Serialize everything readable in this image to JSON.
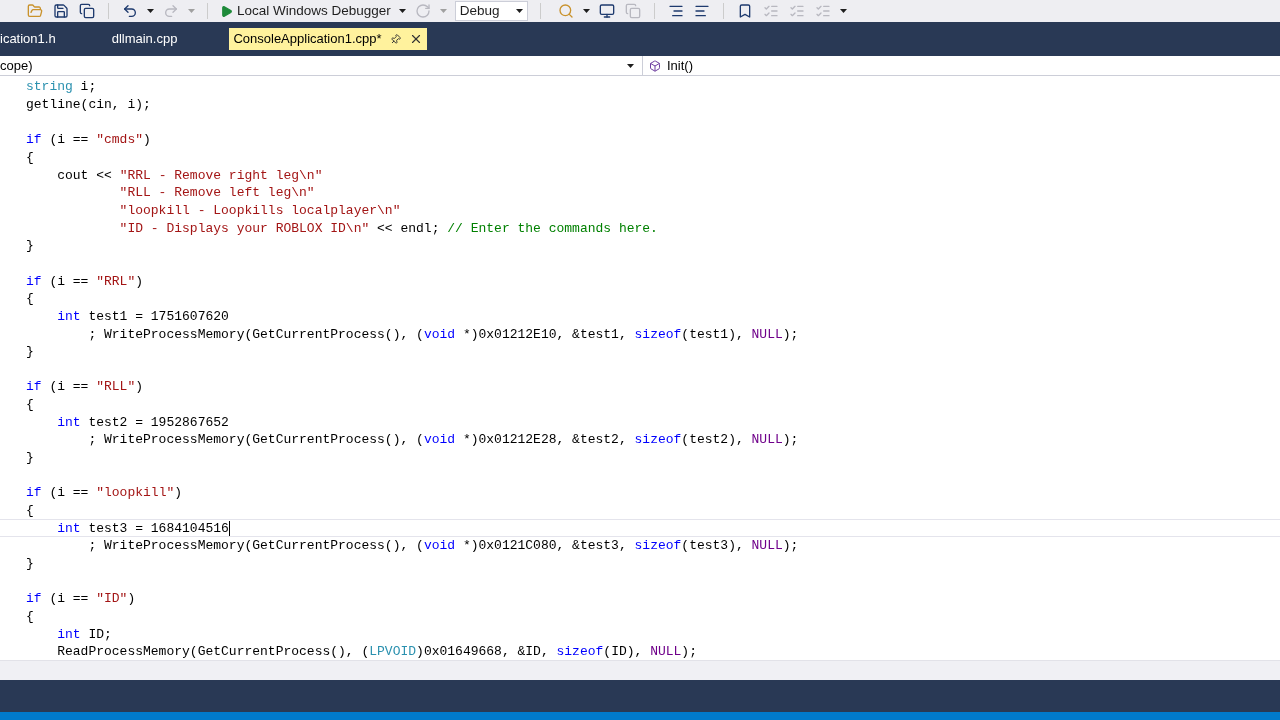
{
  "toolbar": {
    "debugger_button": {
      "label": "Local Windows Debugger"
    },
    "configuration": {
      "value": "Debug"
    }
  },
  "tabs": [
    {
      "label": "ication1.h",
      "selected": false
    },
    {
      "label": "dllmain.cpp",
      "selected": false
    },
    {
      "label": "ConsoleApplication1.cpp*",
      "selected": true
    }
  ],
  "navigation_bar": {
    "scope": "cope)",
    "member": "Init()"
  },
  "editor": {
    "lines": [
      {
        "kind": "code",
        "current": false,
        "tokens": [
          {
            "kind": "type",
            "text": "string"
          },
          {
            "kind": "plain",
            "text": " i;"
          }
        ]
      },
      {
        "kind": "code",
        "current": false,
        "tokens": [
          {
            "kind": "plain",
            "text": "getline(cin, i);"
          }
        ]
      },
      {
        "kind": "blank",
        "current": false
      },
      {
        "kind": "code",
        "current": false,
        "tokens": [
          {
            "kind": "keyword",
            "text": "if"
          },
          {
            "kind": "plain",
            "text": " (i == "
          },
          {
            "kind": "string",
            "text": "\"cmds\""
          },
          {
            "kind": "plain",
            "text": ")"
          }
        ]
      },
      {
        "kind": "code",
        "current": false,
        "tokens": [
          {
            "kind": "plain",
            "text": "{"
          }
        ]
      },
      {
        "kind": "code",
        "current": false,
        "tokens": [
          {
            "kind": "plain",
            "text": "    cout << "
          },
          {
            "kind": "string",
            "text": "\"RRL - Remove right leg\\n\""
          }
        ]
      },
      {
        "kind": "code",
        "current": false,
        "tokens": [
          {
            "kind": "string",
            "text": "            \"RLL - Remove left leg\\n\""
          }
        ]
      },
      {
        "kind": "code",
        "current": false,
        "tokens": [
          {
            "kind": "string",
            "text": "            \"loopkill - Loopkills localplayer\\n\""
          }
        ]
      },
      {
        "kind": "code",
        "current": false,
        "tokens": [
          {
            "kind": "string",
            "text": "            \"ID - Displays your ROBLOX ID\\n\""
          },
          {
            "kind": "plain",
            "text": " << endl; "
          },
          {
            "kind": "comment",
            "text": "// Enter the commands here."
          }
        ]
      },
      {
        "kind": "code",
        "current": false,
        "tokens": [
          {
            "kind": "plain",
            "text": "}"
          }
        ]
      },
      {
        "kind": "blank",
        "current": false
      },
      {
        "kind": "code",
        "current": false,
        "tokens": [
          {
            "kind": "keyword",
            "text": "if"
          },
          {
            "kind": "plain",
            "text": " (i == "
          },
          {
            "kind": "string",
            "text": "\"RRL\""
          },
          {
            "kind": "plain",
            "text": ")"
          }
        ]
      },
      {
        "kind": "code",
        "current": false,
        "tokens": [
          {
            "kind": "plain",
            "text": "{"
          }
        ]
      },
      {
        "kind": "code",
        "current": false,
        "tokens": [
          {
            "kind": "keyword",
            "text": "    int"
          },
          {
            "kind": "plain",
            "text": " test1 = 1751607620"
          }
        ]
      },
      {
        "kind": "code",
        "current": false,
        "tokens": [
          {
            "kind": "plain",
            "text": "        ; WriteProcessMemory(GetCurrentProcess(), ("
          },
          {
            "kind": "keyword",
            "text": "void"
          },
          {
            "kind": "plain",
            "text": " *)0x01212E10, &test1, "
          },
          {
            "kind": "keyword",
            "text": "sizeof"
          },
          {
            "kind": "plain",
            "text": "(test1), "
          },
          {
            "kind": "macro",
            "text": "NULL"
          },
          {
            "kind": "plain",
            "text": ");"
          }
        ]
      },
      {
        "kind": "code",
        "current": false,
        "tokens": [
          {
            "kind": "plain",
            "text": "}"
          }
        ]
      },
      {
        "kind": "blank",
        "current": false
      },
      {
        "kind": "code",
        "current": false,
        "tokens": [
          {
            "kind": "keyword",
            "text": "if"
          },
          {
            "kind": "plain",
            "text": " (i == "
          },
          {
            "kind": "string",
            "text": "\"RLL\""
          },
          {
            "kind": "plain",
            "text": ")"
          }
        ]
      },
      {
        "kind": "code",
        "current": false,
        "tokens": [
          {
            "kind": "plain",
            "text": "{"
          }
        ]
      },
      {
        "kind": "code",
        "current": false,
        "tokens": [
          {
            "kind": "keyword",
            "text": "    int"
          },
          {
            "kind": "plain",
            "text": " test2 = 1952867652"
          }
        ]
      },
      {
        "kind": "code",
        "current": false,
        "tokens": [
          {
            "kind": "plain",
            "text": "        ; WriteProcessMemory(GetCurrentProcess(), ("
          },
          {
            "kind": "keyword",
            "text": "void"
          },
          {
            "kind": "plain",
            "text": " *)0x01212E28, &test2, "
          },
          {
            "kind": "keyword",
            "text": "sizeof"
          },
          {
            "kind": "plain",
            "text": "(test2), "
          },
          {
            "kind": "macro",
            "text": "NULL"
          },
          {
            "kind": "plain",
            "text": ");"
          }
        ]
      },
      {
        "kind": "code",
        "current": false,
        "tokens": [
          {
            "kind": "plain",
            "text": "}"
          }
        ]
      },
      {
        "kind": "blank",
        "current": false
      },
      {
        "kind": "code",
        "current": false,
        "tokens": [
          {
            "kind": "keyword",
            "text": "if"
          },
          {
            "kind": "plain",
            "text": " (i == "
          },
          {
            "kind": "string",
            "text": "\"loopkill\""
          },
          {
            "kind": "plain",
            "text": ")"
          }
        ]
      },
      {
        "kind": "code",
        "current": false,
        "tokens": [
          {
            "kind": "plain",
            "text": "{"
          }
        ]
      },
      {
        "kind": "code",
        "current": true,
        "tokens": [
          {
            "kind": "keyword",
            "text": "    int"
          },
          {
            "kind": "plain",
            "text": " test3 = 1684104516"
          }
        ]
      },
      {
        "kind": "code",
        "current": false,
        "tokens": [
          {
            "kind": "plain",
            "text": "        ; WriteProcessMemory(GetCurrentProcess(), ("
          },
          {
            "kind": "keyword",
            "text": "void"
          },
          {
            "kind": "plain",
            "text": " *)0x0121C080, &test3, "
          },
          {
            "kind": "keyword",
            "text": "sizeof"
          },
          {
            "kind": "plain",
            "text": "(test3), "
          },
          {
            "kind": "macro",
            "text": "NULL"
          },
          {
            "kind": "plain",
            "text": ");"
          }
        ]
      },
      {
        "kind": "code",
        "current": false,
        "tokens": [
          {
            "kind": "plain",
            "text": "}"
          }
        ]
      },
      {
        "kind": "blank",
        "current": false
      },
      {
        "kind": "code",
        "current": false,
        "tokens": [
          {
            "kind": "keyword",
            "text": "if"
          },
          {
            "kind": "plain",
            "text": " (i == "
          },
          {
            "kind": "string",
            "text": "\"ID\""
          },
          {
            "kind": "plain",
            "text": ")"
          }
        ]
      },
      {
        "kind": "code",
        "current": false,
        "tokens": [
          {
            "kind": "plain",
            "text": "{"
          }
        ]
      },
      {
        "kind": "code",
        "current": false,
        "tokens": [
          {
            "kind": "keyword",
            "text": "    int"
          },
          {
            "kind": "plain",
            "text": " ID;"
          }
        ]
      },
      {
        "kind": "code",
        "current": false,
        "tokens": [
          {
            "kind": "plain",
            "text": "    ReadProcessMemory(GetCurrentProcess(), ("
          },
          {
            "kind": "type",
            "text": "LPVOID"
          },
          {
            "kind": "plain",
            "text": ")0x01649668, &ID, "
          },
          {
            "kind": "keyword",
            "text": "sizeof"
          },
          {
            "kind": "plain",
            "text": "(ID), "
          },
          {
            "kind": "macro",
            "text": "NULL"
          },
          {
            "kind": "plain",
            "text": ");"
          }
        ]
      }
    ]
  }
}
